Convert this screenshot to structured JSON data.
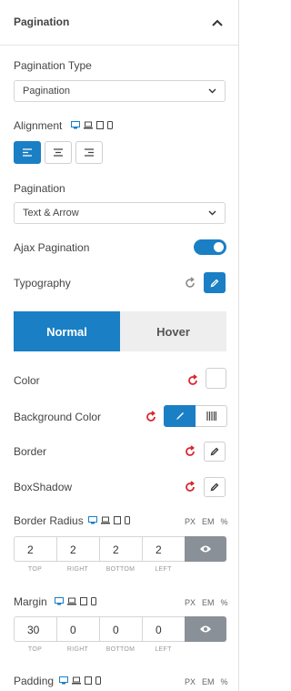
{
  "section": {
    "title": "Pagination"
  },
  "pagination_type": {
    "label": "Pagination Type",
    "value": "Pagination"
  },
  "alignment": {
    "label": "Alignment"
  },
  "pagination": {
    "label": "Pagination",
    "value": "Text & Arrow"
  },
  "ajax": {
    "label": "Ajax Pagination",
    "enabled": true
  },
  "typography": {
    "label": "Typography"
  },
  "tabs": [
    {
      "label": "Normal",
      "active": true
    },
    {
      "label": "Hover",
      "active": false
    }
  ],
  "color": {
    "label": "Color"
  },
  "background_color": {
    "label": "Background Color"
  },
  "border": {
    "label": "Border"
  },
  "box_shadow": {
    "label": "BoxShadow"
  },
  "units": [
    "PX",
    "EM",
    "%"
  ],
  "border_radius": {
    "label": "Border Radius",
    "values": [
      "2",
      "2",
      "2",
      "2"
    ],
    "labels": [
      "TOP",
      "RIGHT",
      "BOTTOM",
      "LEFT"
    ]
  },
  "margin": {
    "label": "Margin",
    "values": [
      "30",
      "0",
      "0",
      "0"
    ],
    "labels": [
      "TOP",
      "RIGHT",
      "BOTTOM",
      "LEFT"
    ]
  },
  "padding": {
    "label": "Padding"
  },
  "colors": {
    "accent": "#1a7fc4",
    "reset": "#d9262c",
    "link": "#8a9097"
  }
}
